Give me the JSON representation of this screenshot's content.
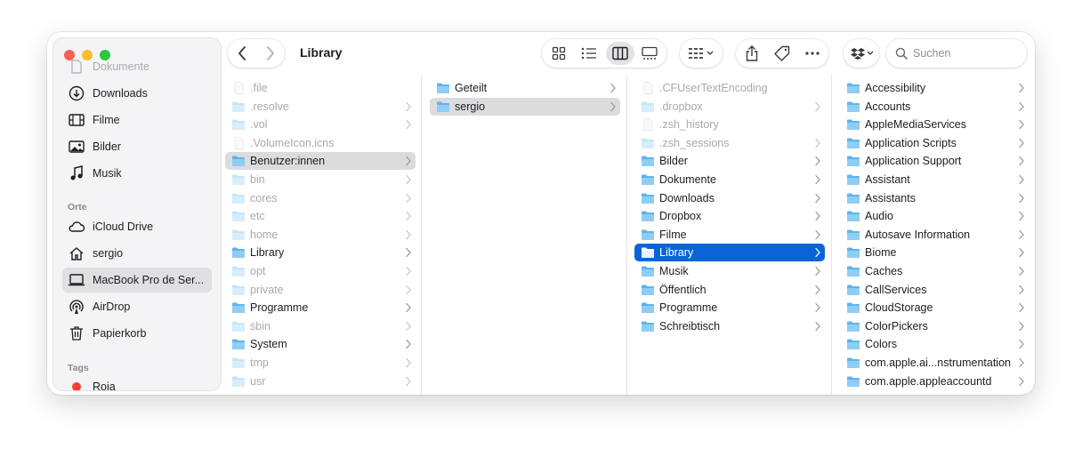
{
  "window": {
    "title": "Library",
    "search_placeholder": "Suchen"
  },
  "sidebar": {
    "partial_top_item": "Dokumente",
    "favorites": [
      {
        "label": "Downloads",
        "icon": "download-circle-icon"
      },
      {
        "label": "Filme",
        "icon": "film-icon"
      },
      {
        "label": "Bilder",
        "icon": "photo-icon"
      },
      {
        "label": "Musik",
        "icon": "music-note-icon"
      }
    ],
    "locations_header": "Orte",
    "locations": [
      {
        "label": "iCloud Drive",
        "icon": "cloud-icon"
      },
      {
        "label": "sergio",
        "icon": "home-icon"
      },
      {
        "label": "MacBook Pro de Ser...",
        "icon": "laptop-icon",
        "selected": true
      },
      {
        "label": "AirDrop",
        "icon": "airdrop-icon"
      },
      {
        "label": "Papierkorb",
        "icon": "trash-icon"
      }
    ],
    "tags_header": "Tags",
    "tags": [
      {
        "label": "Roja",
        "color": "#ff3b30"
      }
    ]
  },
  "columns": [
    {
      "items": [
        {
          "label": ".file",
          "type": "file",
          "hidden": true,
          "chevron": false
        },
        {
          "label": ".resolve",
          "type": "folder",
          "hidden": true,
          "chevron": true
        },
        {
          "label": ".vol",
          "type": "folder",
          "hidden": true,
          "chevron": true
        },
        {
          "label": ".VolumeIcon.icns",
          "type": "file",
          "hidden": true,
          "chevron": false
        },
        {
          "label": "Benutzer:innen",
          "type": "folder",
          "hidden": false,
          "chevron": true,
          "selected": "gray"
        },
        {
          "label": "bin",
          "type": "folder",
          "hidden": true,
          "chevron": true
        },
        {
          "label": "cores",
          "type": "folder",
          "hidden": true,
          "chevron": true
        },
        {
          "label": "etc",
          "type": "folder",
          "hidden": true,
          "chevron": true
        },
        {
          "label": "home",
          "type": "folder",
          "hidden": true,
          "chevron": true
        },
        {
          "label": "Library",
          "type": "folder",
          "hidden": false,
          "chevron": true
        },
        {
          "label": "opt",
          "type": "folder",
          "hidden": true,
          "chevron": true
        },
        {
          "label": "private",
          "type": "folder",
          "hidden": true,
          "chevron": true
        },
        {
          "label": "Programme",
          "type": "folder",
          "hidden": false,
          "chevron": true
        },
        {
          "label": "sbin",
          "type": "folder",
          "hidden": true,
          "chevron": true
        },
        {
          "label": "System",
          "type": "folder",
          "hidden": false,
          "chevron": true
        },
        {
          "label": "tmp",
          "type": "folder",
          "hidden": true,
          "chevron": true
        },
        {
          "label": "usr",
          "type": "folder",
          "hidden": true,
          "chevron": true
        }
      ]
    },
    {
      "items": [
        {
          "label": "Geteilt",
          "type": "folder",
          "hidden": false,
          "chevron": true
        },
        {
          "label": "sergio",
          "type": "folder",
          "hidden": false,
          "chevron": true,
          "selected": "gray"
        }
      ]
    },
    {
      "items": [
        {
          "label": ".CFUserTextEncoding",
          "type": "file",
          "hidden": true,
          "chevron": false
        },
        {
          "label": ".dropbox",
          "type": "folder",
          "hidden": true,
          "chevron": true
        },
        {
          "label": ".zsh_history",
          "type": "file",
          "hidden": true,
          "chevron": false
        },
        {
          "label": ".zsh_sessions",
          "type": "folder",
          "hidden": true,
          "chevron": true
        },
        {
          "label": "Bilder",
          "type": "folder",
          "hidden": false,
          "chevron": true
        },
        {
          "label": "Dokumente",
          "type": "folder",
          "hidden": false,
          "chevron": true
        },
        {
          "label": "Downloads",
          "type": "folder",
          "hidden": false,
          "chevron": true
        },
        {
          "label": "Dropbox",
          "type": "folder",
          "hidden": false,
          "chevron": true
        },
        {
          "label": "Filme",
          "type": "folder",
          "hidden": false,
          "chevron": true
        },
        {
          "label": "Library",
          "type": "folder",
          "hidden": false,
          "chevron": true,
          "selected": "blue"
        },
        {
          "label": "Musik",
          "type": "folder",
          "hidden": false,
          "chevron": true
        },
        {
          "label": "Öffentlich",
          "type": "folder",
          "hidden": false,
          "chevron": true
        },
        {
          "label": "Programme",
          "type": "folder",
          "hidden": false,
          "chevron": true
        },
        {
          "label": "Schreibtisch",
          "type": "folder",
          "hidden": false,
          "chevron": true
        }
      ]
    },
    {
      "items": [
        {
          "label": "Accessibility",
          "type": "folder",
          "hidden": false,
          "chevron": true
        },
        {
          "label": "Accounts",
          "type": "folder",
          "hidden": false,
          "chevron": true
        },
        {
          "label": "AppleMediaServices",
          "type": "folder",
          "hidden": false,
          "chevron": true
        },
        {
          "label": "Application Scripts",
          "type": "folder",
          "hidden": false,
          "chevron": true
        },
        {
          "label": "Application Support",
          "type": "folder",
          "hidden": false,
          "chevron": true
        },
        {
          "label": "Assistant",
          "type": "folder",
          "hidden": false,
          "chevron": true
        },
        {
          "label": "Assistants",
          "type": "folder",
          "hidden": false,
          "chevron": true
        },
        {
          "label": "Audio",
          "type": "folder",
          "hidden": false,
          "chevron": true
        },
        {
          "label": "Autosave Information",
          "type": "folder",
          "hidden": false,
          "chevron": true
        },
        {
          "label": "Biome",
          "type": "folder",
          "hidden": false,
          "chevron": true
        },
        {
          "label": "Caches",
          "type": "folder",
          "hidden": false,
          "chevron": true
        },
        {
          "label": "CallServices",
          "type": "folder",
          "hidden": false,
          "chevron": true
        },
        {
          "label": "CloudStorage",
          "type": "folder",
          "hidden": false,
          "chevron": true
        },
        {
          "label": "ColorPickers",
          "type": "folder",
          "hidden": false,
          "chevron": true
        },
        {
          "label": "Colors",
          "type": "folder",
          "hidden": false,
          "chevron": true
        },
        {
          "label": "com.apple.ai...nstrumentation",
          "type": "folder",
          "hidden": false,
          "chevron": true
        },
        {
          "label": "com.apple.appleaccountd",
          "type": "folder",
          "hidden": false,
          "chevron": true
        }
      ]
    }
  ],
  "colors": {
    "accent": "#0964d8",
    "folder": "#5eb3ee",
    "tag_red": "#ff3b30"
  }
}
